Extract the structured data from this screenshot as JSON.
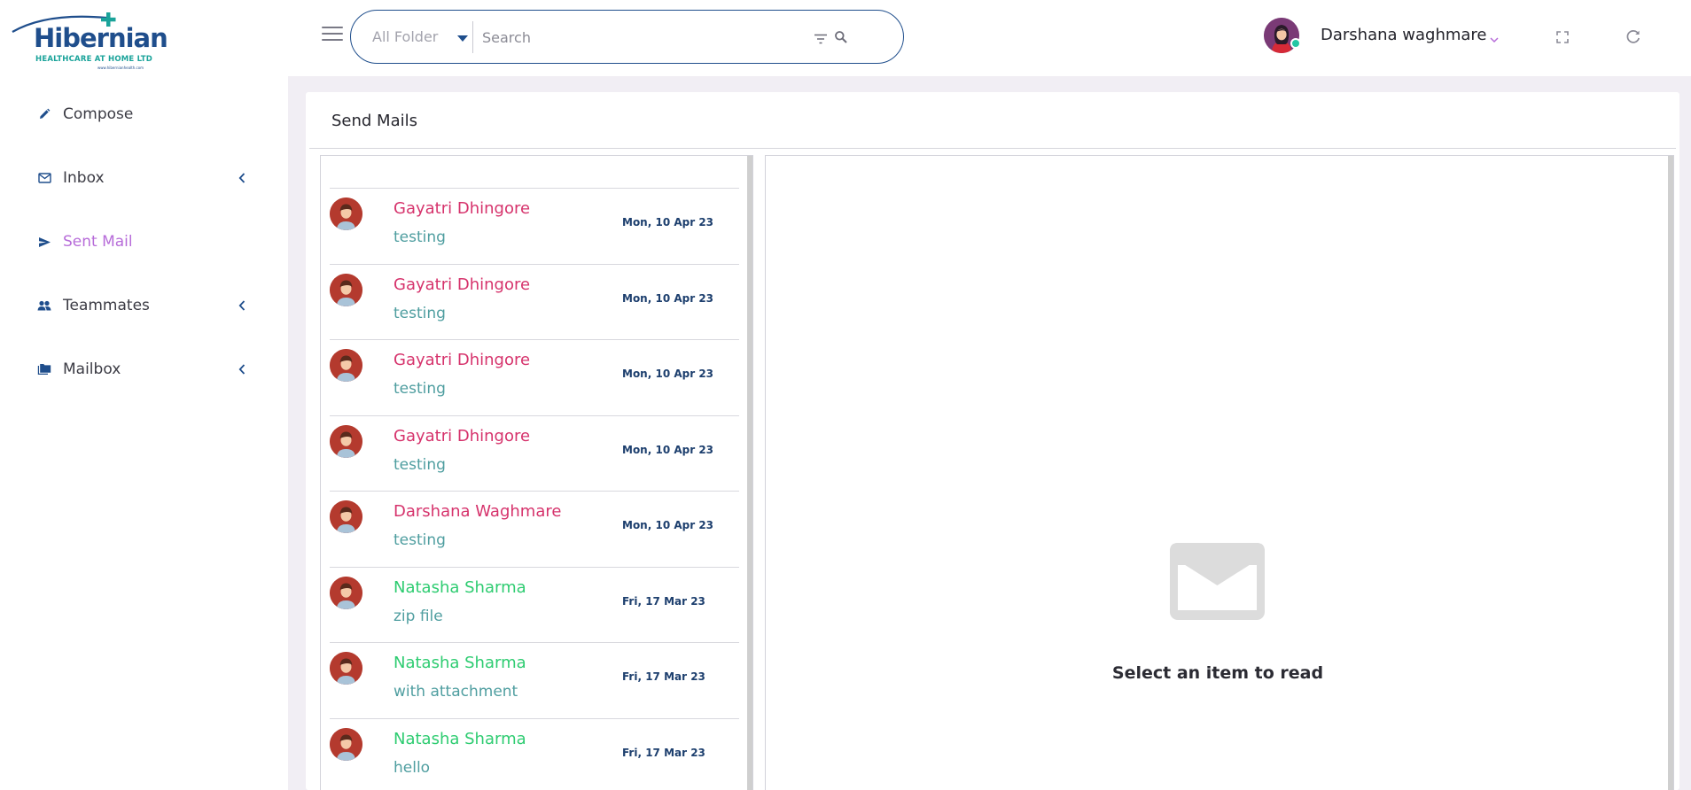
{
  "brand": {
    "name": "Hibernian",
    "tagline": "HEALTHCARE AT HOME LTD",
    "website": "www.hibernianhealth.com"
  },
  "sidebar": {
    "items": [
      {
        "label": "Compose",
        "icon": "pencil-icon",
        "active": false,
        "has_submenu": false
      },
      {
        "label": "Inbox",
        "icon": "mail-outline-icon",
        "active": false,
        "has_submenu": true
      },
      {
        "label": "Sent Mail",
        "icon": "send-icon",
        "active": true,
        "has_submenu": false
      },
      {
        "label": "Teammates",
        "icon": "people-icon",
        "active": false,
        "has_submenu": true
      },
      {
        "label": "Mailbox",
        "icon": "folders-icon",
        "active": false,
        "has_submenu": true
      }
    ]
  },
  "topbar": {
    "folder_filter": "All Folder",
    "search_placeholder": "Search",
    "user_name": "Darshana waghmare",
    "user_status": "online"
  },
  "main": {
    "title": "Send Mails",
    "mails": [
      {
        "sender": "Gayatri Dhingore",
        "subject": "testing",
        "date": "Mon, 10 Apr 23",
        "sender_color": "#d6336c"
      },
      {
        "sender": "Gayatri Dhingore",
        "subject": "testing",
        "date": "Mon, 10 Apr 23",
        "sender_color": "#d6336c"
      },
      {
        "sender": "Gayatri Dhingore",
        "subject": "testing",
        "date": "Mon, 10 Apr 23",
        "sender_color": "#d6336c"
      },
      {
        "sender": "Gayatri Dhingore",
        "subject": "testing",
        "date": "Mon, 10 Apr 23",
        "sender_color": "#d6336c"
      },
      {
        "sender": "Darshana Waghmare",
        "subject": "testing",
        "date": "Mon, 10 Apr 23",
        "sender_color": "#d6336c"
      },
      {
        "sender": "Natasha Sharma",
        "subject": "zip file",
        "date": "Fri, 17 Mar 23",
        "sender_color": "#2ecc71"
      },
      {
        "sender": "Natasha Sharma",
        "subject": "with attachment",
        "date": "Fri, 17 Mar 23",
        "sender_color": "#2ecc71"
      },
      {
        "sender": "Natasha Sharma",
        "subject": "hello",
        "date": "Fri, 17 Mar 23",
        "sender_color": "#2ecc71"
      }
    ],
    "reading_pane": {
      "empty_text": "Select an item to read",
      "icon": "envelope-icon"
    }
  },
  "colors": {
    "brand_blue": "#1f4e8c",
    "brand_teal": "#1aa39a",
    "active_nav": "#b76cd9",
    "subject_teal": "#4f9ea0",
    "date_navy": "#1d3f6e",
    "page_bg": "#f1eef4"
  }
}
